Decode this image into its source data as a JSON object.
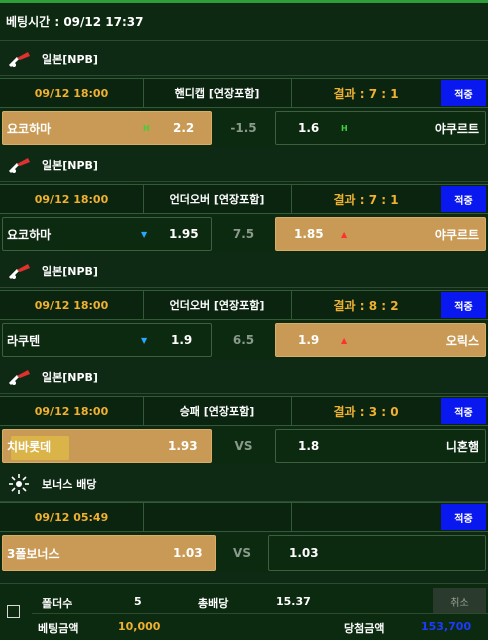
{
  "header": {
    "title": "베팅시간 : 09/12 17:37"
  },
  "bets": [
    {
      "league": "일본[NPB]",
      "date": "09/12 18:00",
      "market": "핸디캡 [연장포함]",
      "result": "결과 : 7 : 1",
      "apply": "적중",
      "home": "요코하마",
      "home_odds": "2.2",
      "home_mark": "H",
      "middle": "-1.5",
      "away": "야쿠르트",
      "away_odds": "1.6",
      "away_mark": "H",
      "selected": "home"
    },
    {
      "league": "일본[NPB]",
      "date": "09/12 18:00",
      "market": "언더오버 [연장포함]",
      "result": "결과 : 7 : 1",
      "apply": "적중",
      "home": "요코하마",
      "home_odds": "1.95",
      "home_mark": "▼",
      "middle": "7.5",
      "away": "야쿠르트",
      "away_odds": "1.85",
      "away_mark": "▲",
      "selected": "away"
    },
    {
      "league": "일본[NPB]",
      "date": "09/12 18:00",
      "market": "언더오버 [연장포함]",
      "result": "결과 : 8 : 2",
      "apply": "적중",
      "home": "라쿠텐",
      "home_odds": "1.9",
      "home_mark": "▼",
      "middle": "6.5",
      "away": "오릭스",
      "away_odds": "1.9",
      "away_mark": "▲",
      "selected": "away"
    },
    {
      "league": "일본[NPB]",
      "date": "09/12 18:00",
      "market": "승패 [연장포함]",
      "result": "결과 : 3 : 0",
      "apply": "적중",
      "home": "치바롯데",
      "home_odds": "1.93",
      "home_mark": "",
      "middle": "VS",
      "away": "니혼햄",
      "away_odds": "1.8",
      "away_mark": "",
      "selected": "home"
    }
  ],
  "bonus": {
    "league": "보너스 배당",
    "date": "09/12 05:49",
    "apply": "적중",
    "name": "3폴보너스",
    "odds": "1.03",
    "middle": "VS",
    "right_odds": "1.03"
  },
  "footer": {
    "folder_label": "폴더수",
    "folder_value": "5",
    "total_odds_label": "총배당",
    "total_odds_value": "15.37",
    "cancel_label": "취소",
    "bet_amount_label": "베팅금액",
    "bet_amount_value": "10,000",
    "win_amount_label": "당첨금액",
    "win_amount_value": "153,700"
  },
  "colors": {
    "accent": "#f0b030",
    "apply_bg": "#0a18f0",
    "selected_bg": "#c99a55",
    "win_amount": "#1a3cff"
  }
}
